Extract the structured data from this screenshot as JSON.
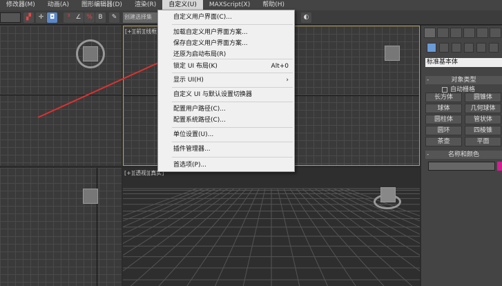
{
  "menubar": {
    "items": [
      "修改器(M)",
      "动画(A)",
      "图形编辑器(D)",
      "渲染(R)",
      "自定义(U)",
      "MAXScript(X)",
      "帮助(H)"
    ],
    "active": "自定义(U)"
  },
  "toolbar": {
    "named_selection_placeholder": "创建选择集"
  },
  "viewports": {
    "top_right_label": "[+][前][线框]",
    "bottom_right_label": "[+][透视][真实]"
  },
  "customize_menu": {
    "items": [
      {
        "label": "自定义用户界面(C)...",
        "shortcut": ""
      },
      {
        "label": "加载自定义用户界面方案...",
        "shortcut": ""
      },
      {
        "label": "保存自定义用户界面方案...",
        "shortcut": ""
      },
      {
        "label": "还原为启动布局(R)",
        "shortcut": ""
      },
      {
        "label": "锁定 UI 布局(K)",
        "shortcut": "Alt+0"
      },
      {
        "label": "显示 UI(H)",
        "shortcut": "›"
      },
      {
        "label": "自定义 UI 与默认设置切换器",
        "shortcut": ""
      },
      {
        "label": "配置用户路径(C)...",
        "shortcut": ""
      },
      {
        "label": "配置系统路径(C)...",
        "shortcut": ""
      },
      {
        "label": "单位设置(U)...",
        "shortcut": ""
      },
      {
        "label": "插件管理器...",
        "shortcut": ""
      },
      {
        "label": "首选项(P)...",
        "shortcut": ""
      }
    ]
  },
  "command_panel": {
    "primitive_type": "标准基本体",
    "object_type_title": "对象类型",
    "autogrid": "自动栅格",
    "objects": [
      "长方体",
      "圆锥体",
      "球体",
      "几何球体",
      "圆柱体",
      "管状体",
      "圆环",
      "四棱锥",
      "茶壶",
      "平面"
    ],
    "name_color_title": "名称和颜色",
    "collapse": "-"
  },
  "colors": {
    "arrow": "#e03030",
    "swatch": "#d02090"
  }
}
